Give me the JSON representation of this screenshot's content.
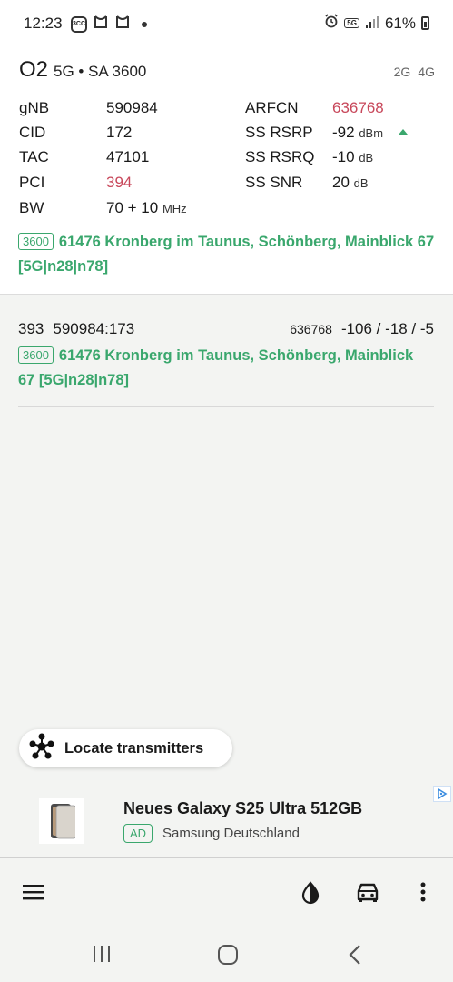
{
  "status_bar": {
    "time": "12:23",
    "left_icons": [
      "3cc-icon",
      "mi-home-icon",
      "mi-home-icon"
    ],
    "battery": "61%",
    "network_badge": "5G"
  },
  "serving": {
    "operator": "O2",
    "tech": "5G • SA 3600",
    "bands": [
      "2G",
      "4G"
    ],
    "left": [
      {
        "label": "gNB",
        "value": "590984",
        "unit": ""
      },
      {
        "label": "CID",
        "value": "172",
        "unit": ""
      },
      {
        "label": "TAC",
        "value": "47101",
        "unit": ""
      },
      {
        "label": "PCI",
        "value": "394",
        "unit": ""
      },
      {
        "label": "BW",
        "value": "70 + 10",
        "unit": "MHz"
      }
    ],
    "right": [
      {
        "label": "ARFCN",
        "value": "636768",
        "unit": ""
      },
      {
        "label": "SS RSRP",
        "value": "-92",
        "unit": "dBm"
      },
      {
        "label": "SS RSRQ",
        "value": "-10",
        "unit": "dB"
      },
      {
        "label": "SS SNR",
        "value": "20",
        "unit": "dB"
      }
    ],
    "site_badge": "3600",
    "site_text": "61476 Kronberg im Taunus, Schönberg, Mainblick 67 [5G|n28|n78]"
  },
  "neighbor": {
    "pci": "393",
    "cell_id": "590984:173",
    "arfcn": "636768",
    "signal": "-106 / -18 / -5",
    "site_badge": "3600",
    "site_text": "61476 Kronberg im Taunus, Schönberg, Mainblick 67 [5G|n28|n78]"
  },
  "locate_button": {
    "label": "Locate transmitters"
  },
  "ad": {
    "title": "Neues Galaxy S25 Ultra 512GB",
    "badge": "AD",
    "sponsor": "Samsung Deutschland"
  },
  "bottom_bar": {
    "icons": [
      "menu-icon",
      "contrast-icon",
      "car-icon",
      "more-vert-icon"
    ]
  },
  "colors": {
    "accent_green": "#3aa76d",
    "highlight_red": "#c8485b"
  }
}
